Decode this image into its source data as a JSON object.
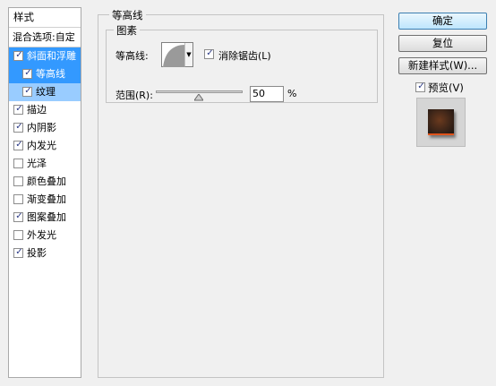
{
  "style_list": {
    "header": "样式",
    "blending": "混合选项:自定",
    "items": [
      {
        "label": "斜面和浮雕",
        "checked": true
      },
      {
        "label": "等高线",
        "checked": true
      },
      {
        "label": "纹理",
        "checked": true
      },
      {
        "label": "描边",
        "checked": true
      },
      {
        "label": "内阴影",
        "checked": true
      },
      {
        "label": "内发光",
        "checked": true
      },
      {
        "label": "光泽",
        "checked": false
      },
      {
        "label": "颜色叠加",
        "checked": false
      },
      {
        "label": "渐变叠加",
        "checked": false
      },
      {
        "label": "图案叠加",
        "checked": true
      },
      {
        "label": "外发光",
        "checked": false
      },
      {
        "label": "投影",
        "checked": true
      }
    ]
  },
  "panel": {
    "title": "等高线",
    "elements_title": "图素",
    "contour_label": "等高线:",
    "antialias_label": "消除锯齿(L)",
    "antialias_checked": true,
    "range_label": "范围(R):",
    "range_value": "50",
    "range_percent": 50,
    "range_unit": "%"
  },
  "buttons": {
    "ok": "确定",
    "reset": "复位",
    "new_style": "新建样式(W)..."
  },
  "preview": {
    "label": "预览(V)",
    "checked": true
  },
  "colors": {
    "selected_row": "#3399ff",
    "sub_selected_row": "#99ccff",
    "check_mark": "#2b3a86"
  }
}
